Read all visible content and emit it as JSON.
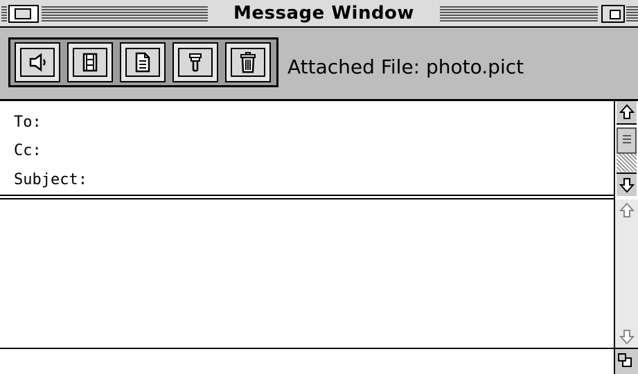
{
  "window": {
    "title": "Message Window"
  },
  "toolbar": {
    "buttons": [
      {
        "name": "sound-button",
        "icon": "speaker-icon"
      },
      {
        "name": "movie-button",
        "icon": "film-icon"
      },
      {
        "name": "document-button",
        "icon": "document-icon"
      },
      {
        "name": "tool-button",
        "icon": "wrench-icon"
      },
      {
        "name": "trash-button",
        "icon": "trash-icon"
      }
    ],
    "attached_file": "Attached File: photo.pict"
  },
  "header": {
    "to_label": "To:",
    "cc_label": "Cc:",
    "subject_label": "Subject:"
  },
  "colors": {
    "titlebar": "#dcdcdc",
    "toolbar": "#bdbdbd",
    "button_face": "#d8d8d8"
  }
}
